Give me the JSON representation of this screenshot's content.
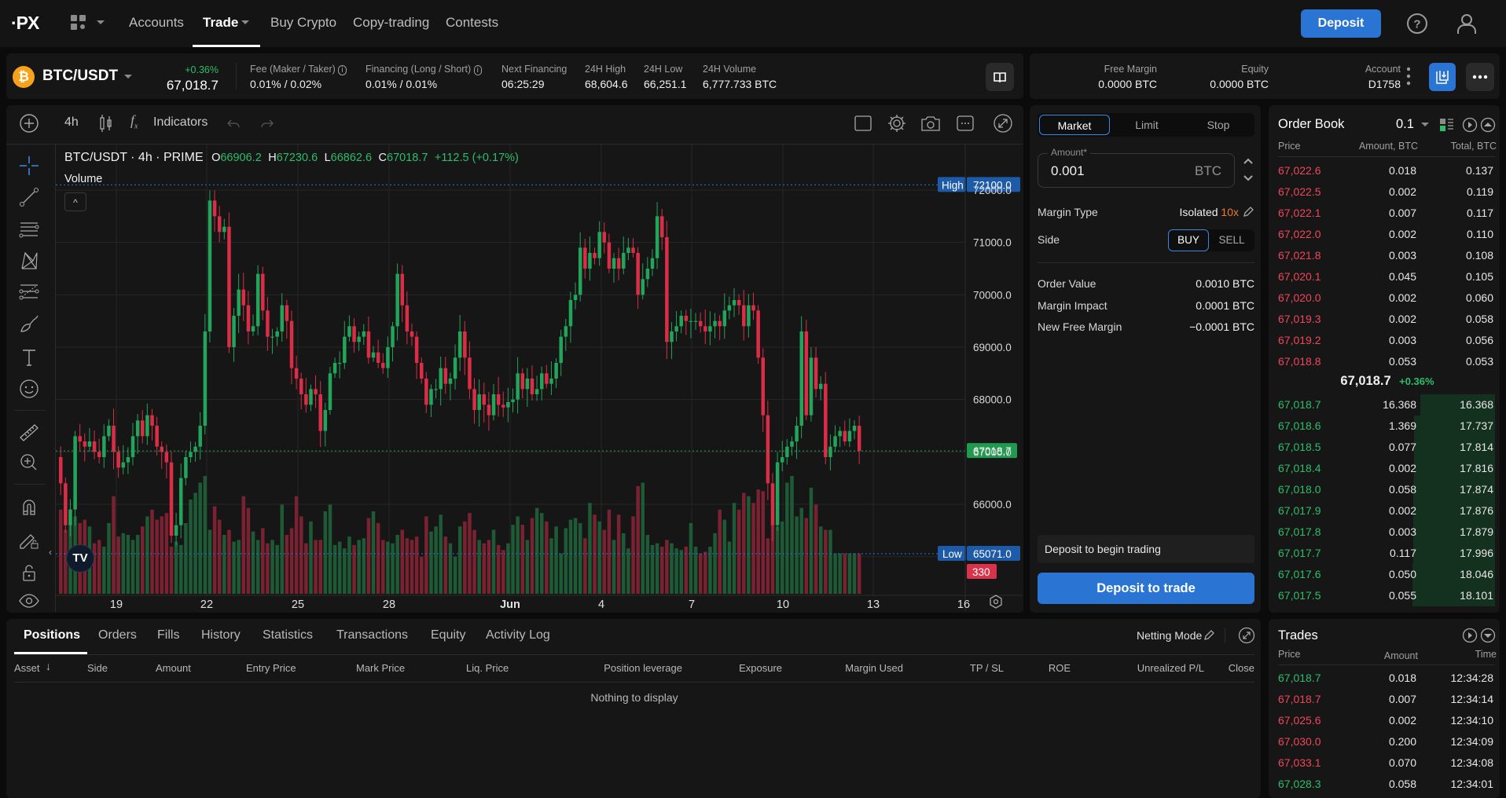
{
  "nav": {
    "logo": "·PX",
    "items": [
      {
        "label": "Accounts",
        "active": false
      },
      {
        "label": "Trade",
        "active": true,
        "dropdown": true
      },
      {
        "label": "Buy Crypto",
        "active": false
      },
      {
        "label": "Copy-trading",
        "active": false
      },
      {
        "label": "Contests",
        "active": false
      }
    ],
    "deposit_label": "Deposit",
    "icons": [
      "apps-icon",
      "help-icon",
      "user-icon"
    ]
  },
  "ticker": {
    "symbol": "BTC/USDT",
    "coin_icon": "₿",
    "change_pct": "+0.36%",
    "last_price": "67,018.7",
    "stats": [
      {
        "label": "Fee (Maker / Taker)",
        "value": "0.01% / 0.02%",
        "info": true
      },
      {
        "label": "Financing (Long / Short)",
        "value": "0.01% / 0.01%",
        "info": true
      },
      {
        "label": "Next Financing",
        "value": "06:25:29",
        "info": false
      },
      {
        "label": "24H High",
        "value": "68,604.6",
        "info": false
      },
      {
        "label": "24H Low",
        "value": "66,251.1",
        "info": false
      },
      {
        "label": "24H Volume",
        "value": "6,777.733 BTC",
        "info": false
      }
    ]
  },
  "account": {
    "free_margin_label": "Free Margin",
    "free_margin_value": "0.0000 BTC",
    "equity_label": "Equity",
    "equity_value": "0.0000 BTC",
    "account_label": "Account",
    "account_value": "D1758"
  },
  "chart_toolbar": {
    "interval": "4h",
    "indicators_label": "Indicators"
  },
  "chart_data": {
    "type": "candlestick",
    "title": "BTC/USDT · 4h · PRIME",
    "ohlc_legend": {
      "O": "66906.2",
      "H": "67230.6",
      "L": "66862.6",
      "C": "67018.7",
      "change": "+112.5 (+0.17%)"
    },
    "volume_label": "Volume",
    "y_ticks": [
      "72000.0",
      "71000.0",
      "70000.0",
      "69000.0",
      "68000.0",
      "67000.0",
      "66000.0"
    ],
    "ylim": [
      64500,
      72500
    ],
    "x_ticks": [
      "19",
      "22",
      "25",
      "28",
      "Jun",
      "4",
      "7",
      "10",
      "13",
      "16"
    ],
    "markers": {
      "high": {
        "label": "High",
        "value": "72100.0"
      },
      "low": {
        "label": "Low",
        "value": "65071.0"
      },
      "last": {
        "value": "67018.7"
      },
      "volume_last": "330"
    },
    "closes": [
      66400,
      65600,
      65900,
      67300,
      67200,
      67100,
      67200,
      67000,
      66900,
      67300,
      67500,
      67000,
      66700,
      66800,
      66900,
      67300,
      67600,
      67300,
      67700,
      67500,
      67100,
      67000,
      66800,
      65400,
      65600,
      66500,
      66900,
      67000,
      67100,
      67500,
      69300,
      71800,
      71500,
      71200,
      71300,
      69000,
      69600,
      70100,
      69800,
      69300,
      69400,
      70400,
      69700,
      69200,
      69200,
      69300,
      69800,
      69500,
      68600,
      68400,
      68100,
      67900,
      68200,
      68100,
      67400,
      67800,
      68500,
      68700,
      68700,
      69200,
      69400,
      69100,
      69200,
      69300,
      68800,
      68900,
      68700,
      68600,
      69000,
      69400,
      70400,
      69800,
      69300,
      69200,
      68700,
      68400,
      67900,
      68200,
      68200,
      68600,
      68300,
      68400,
      68800,
      69300,
      68800,
      68200,
      67800,
      68100,
      67900,
      67700,
      68100,
      67900,
      67850,
      67950,
      68000,
      68500,
      68200,
      68400,
      68100,
      68200,
      68500,
      68300,
      68400,
      68700,
      69200,
      69400,
      69900,
      70000,
      70900,
      70500,
      70800,
      70700,
      71200,
      71000,
      70500,
      70700,
      70500,
      70800,
      70900,
      70800,
      70000,
      70300,
      70500,
      70700,
      71500,
      71100,
      69100,
      69300,
      69400,
      69600,
      69500,
      69500,
      69500,
      69400,
      69300,
      69400,
      69500,
      69400,
      69700,
      69800,
      69900,
      69800,
      69400,
      69800,
      69700,
      68800,
      67700,
      66400,
      65600,
      66800,
      66900,
      67100,
      67200,
      67500,
      69300,
      67700,
      68800,
      68200,
      68300,
      66900,
      67100,
      67300,
      67400,
      67200,
      67400,
      67500,
      67019
    ],
    "volumes": [
      250,
      190,
      210,
      230,
      210,
      220,
      200,
      150,
      160,
      140,
      210,
      290,
      170,
      180,
      175,
      160,
      175,
      200,
      230,
      250,
      220,
      230,
      240,
      140,
      155,
      145,
      210,
      280,
      300,
      330,
      350,
      190,
      260,
      220,
      175,
      190,
      155,
      160,
      290,
      255,
      185,
      160,
      195,
      150,
      160,
      145,
      265,
      175,
      195,
      290,
      230,
      150,
      215,
      160,
      160,
      245,
      265,
      145,
      155,
      135,
      170,
      145,
      160,
      165,
      225,
      245,
      210,
      160,
      155,
      150,
      175,
      190,
      165,
      160,
      170,
      110,
      230,
      185,
      200,
      235,
      170,
      150,
      110,
      200,
      215,
      240,
      190,
      160,
      150,
      160,
      190,
      145,
      130,
      150,
      205,
      230,
      205,
      160,
      225,
      255,
      240,
      215,
      165,
      200,
      120,
      195,
      220,
      225,
      210,
      165,
      270,
      235,
      215,
      190,
      250,
      160,
      235,
      180,
      135,
      230,
      320,
      330,
      175,
      145,
      150,
      140,
      160,
      150,
      135,
      130,
      140,
      210,
      140,
      120,
      125,
      140,
      180,
      250,
      220,
      155,
      270,
      250,
      300,
      290,
      270,
      310,
      305,
      165,
      210,
      200,
      215,
      330,
      350,
      230,
      255,
      225,
      315,
      265,
      200,
      190,
      190,
      120
    ],
    "y_axis_side": "right",
    "grid": true
  },
  "order_form": {
    "tabs": [
      {
        "label": "Market",
        "active": true
      },
      {
        "label": "Limit",
        "active": false
      },
      {
        "label": "Stop",
        "active": false
      }
    ],
    "amount_label": "Amount*",
    "amount_value": "0.001",
    "amount_unit": "BTC",
    "margin_type_label": "Margin Type",
    "margin_type_value": "Isolated",
    "leverage": "10x",
    "side_label": "Side",
    "side_options": [
      {
        "label": "BUY",
        "active": true
      },
      {
        "label": "SELL",
        "active": false
      }
    ],
    "summary": [
      {
        "label": "Order Value",
        "value": "0.0010 BTC"
      },
      {
        "label": "Margin Impact",
        "value": "0.0001 BTC"
      },
      {
        "label": "New Free Margin",
        "value": "−0.0001 BTC"
      }
    ],
    "notice": "Deposit to begin trading",
    "submit_label": "Deposit to trade"
  },
  "order_book": {
    "title": "Order Book",
    "precision": "0.1",
    "headers": [
      "Price",
      "Amount, BTC",
      "Total, BTC"
    ],
    "asks": [
      {
        "price": "67,022.6",
        "amount": "0.018",
        "total": "0.137"
      },
      {
        "price": "67,022.5",
        "amount": "0.002",
        "total": "0.119"
      },
      {
        "price": "67,022.1",
        "amount": "0.007",
        "total": "0.117"
      },
      {
        "price": "67,022.0",
        "amount": "0.002",
        "total": "0.110"
      },
      {
        "price": "67,021.8",
        "amount": "0.003",
        "total": "0.108"
      },
      {
        "price": "67,020.1",
        "amount": "0.045",
        "total": "0.105"
      },
      {
        "price": "67,020.0",
        "amount": "0.002",
        "total": "0.060"
      },
      {
        "price": "67,019.3",
        "amount": "0.002",
        "total": "0.058"
      },
      {
        "price": "67,019.2",
        "amount": "0.003",
        "total": "0.056"
      },
      {
        "price": "67,018.8",
        "amount": "0.053",
        "total": "0.053"
      }
    ],
    "mid_price": "67,018.7",
    "mid_change": "+0.36%",
    "bids": [
      {
        "price": "67,018.7",
        "amount": "16.368",
        "total": "16.368"
      },
      {
        "price": "67,018.6",
        "amount": "1.369",
        "total": "17.737"
      },
      {
        "price": "67,018.5",
        "amount": "0.077",
        "total": "17.814"
      },
      {
        "price": "67,018.4",
        "amount": "0.002",
        "total": "17.816"
      },
      {
        "price": "67,018.0",
        "amount": "0.058",
        "total": "17.874"
      },
      {
        "price": "67,017.9",
        "amount": "0.002",
        "total": "17.876"
      },
      {
        "price": "67,017.8",
        "amount": "0.003",
        "total": "17.879"
      },
      {
        "price": "67,017.7",
        "amount": "0.117",
        "total": "17.996"
      },
      {
        "price": "67,017.6",
        "amount": "0.050",
        "total": "18.046"
      },
      {
        "price": "67,017.5",
        "amount": "0.055",
        "total": "18.101"
      }
    ]
  },
  "trades": {
    "title": "Trades",
    "headers": [
      "Price",
      "Amount",
      "Time"
    ],
    "rows": [
      {
        "price": "67,018.7",
        "amount": "0.018",
        "time": "12:34:28",
        "side": "buy"
      },
      {
        "price": "67,018.7",
        "amount": "0.007",
        "time": "12:34:14",
        "side": "sell"
      },
      {
        "price": "67,025.6",
        "amount": "0.002",
        "time": "12:34:10",
        "side": "sell"
      },
      {
        "price": "67,030.0",
        "amount": "0.200",
        "time": "12:34:09",
        "side": "sell"
      },
      {
        "price": "67,033.1",
        "amount": "0.070",
        "time": "12:34:08",
        "side": "sell"
      },
      {
        "price": "67,028.3",
        "amount": "0.058",
        "time": "12:34:01",
        "side": "buy"
      }
    ]
  },
  "positions": {
    "tabs": [
      "Positions",
      "Orders",
      "Fills",
      "History",
      "Statistics",
      "Transactions",
      "Equity",
      "Activity Log"
    ],
    "active_tab": "Positions",
    "netting_mode": "Netting Mode",
    "columns": [
      "Asset",
      "Side",
      "Amount",
      "Entry Price",
      "Mark Price",
      "Liq. Price",
      "Position leverage",
      "Exposure",
      "Margin Used",
      "TP / SL",
      "ROE",
      "Unrealized P/L",
      "Close"
    ],
    "empty_text": "Nothing to display"
  },
  "colors": {
    "up": "#22a45a",
    "down": "#dc2d47",
    "accent": "#2a74d4",
    "leverage": "#f07a2a"
  }
}
